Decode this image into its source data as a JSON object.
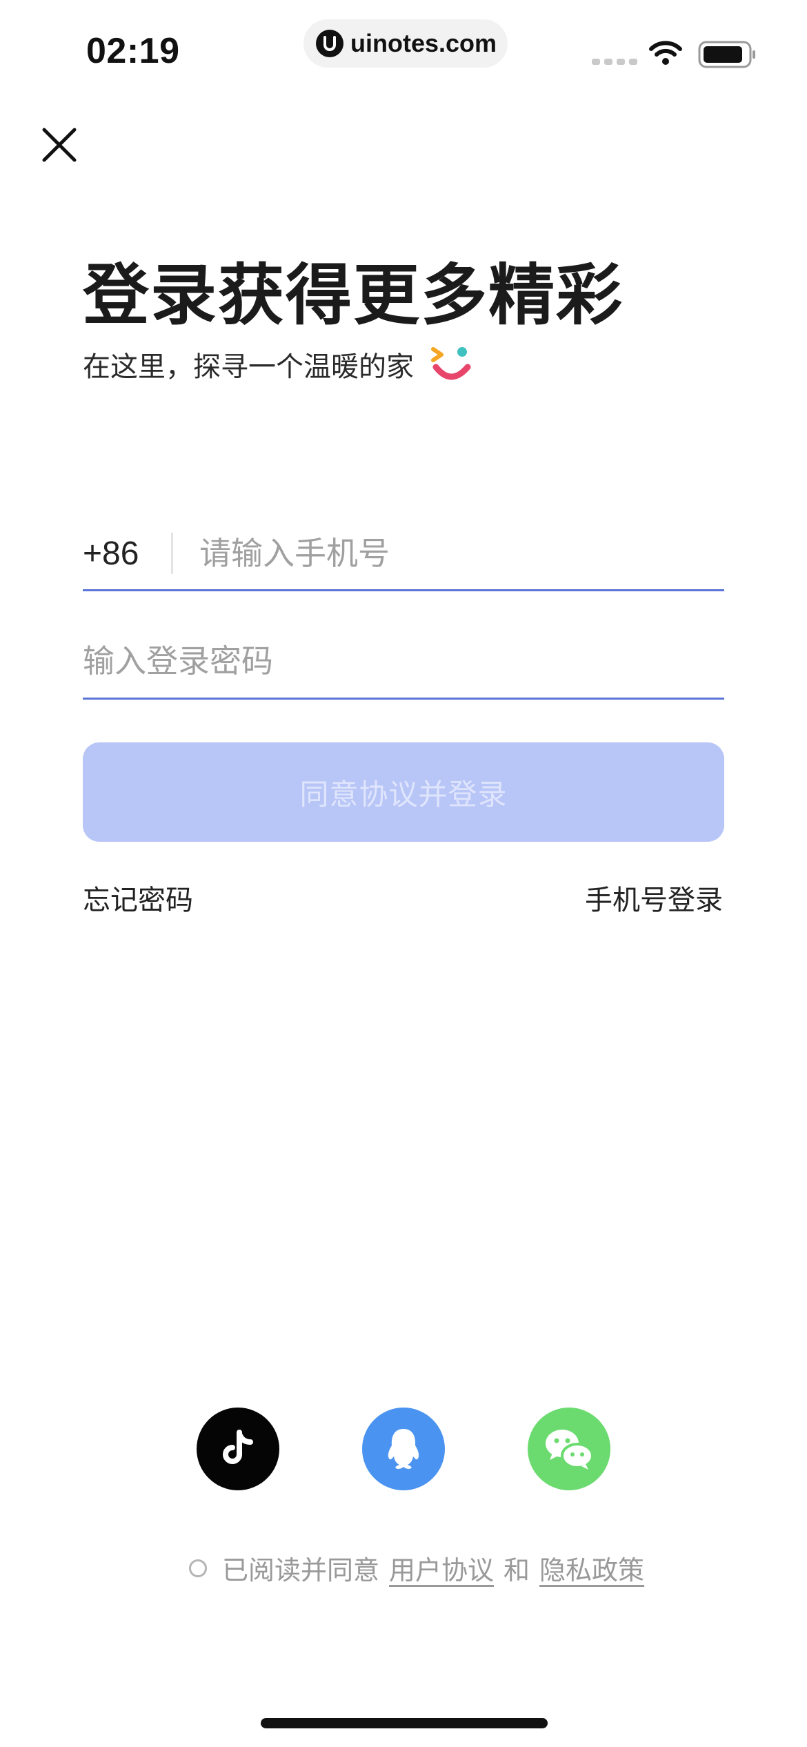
{
  "status_bar": {
    "time": "02:19",
    "url": "uinotes.com"
  },
  "header": {
    "close_icon": "close-icon"
  },
  "hero": {
    "title": "登录获得更多精彩",
    "subtitle": "在这里，探寻一个温暖的家"
  },
  "form": {
    "country_code": "+86",
    "phone_placeholder": "请输入手机号",
    "phone_value": "",
    "password_placeholder": "输入登录密码",
    "password_value": "",
    "login_label": "同意协议并登录",
    "forgot_label": "忘记密码",
    "phone_login_label": "手机号登录"
  },
  "social": [
    {
      "icon": "tiktok-icon"
    },
    {
      "icon": "qq-icon"
    },
    {
      "icon": "wechat-icon"
    }
  ],
  "agreement": {
    "prefix": "已阅读并同意",
    "user_agreement": "用户协议",
    "and": "和",
    "privacy_policy": "隐私政策"
  },
  "colors": {
    "accent": "#5b74d8",
    "button_disabled": "#b8c5f7",
    "qq": "#4a93f0",
    "wechat": "#6bdb6f"
  }
}
